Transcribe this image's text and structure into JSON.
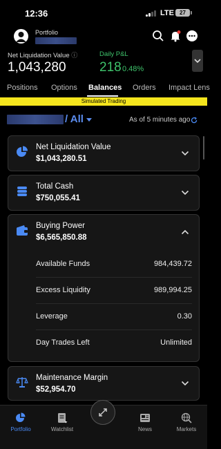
{
  "status": {
    "time": "12:36",
    "network": "LTE",
    "battery": "27"
  },
  "header": {
    "portfolio_label": "Portfolio"
  },
  "summary": {
    "liq_label": "Net Liquidation Value",
    "liq_value": "1,043,280",
    "pnl_label": "Daily P&L",
    "pnl_value": "218",
    "pnl_pct": "0.48%"
  },
  "tabs": [
    {
      "label": "Positions"
    },
    {
      "label": "Options"
    },
    {
      "label": "Balances"
    },
    {
      "label": "Orders"
    },
    {
      "label": "Impact Lens"
    }
  ],
  "active_tab": "Balances",
  "banner": "Simulated Trading",
  "account": {
    "selector": "/ All",
    "as_of": "As of 5 minutes ago"
  },
  "cards": {
    "nlv": {
      "title": "Net Liquidation Value",
      "value": "$1,043,280.51",
      "icon": "pie-chart-icon"
    },
    "cash": {
      "title": "Total Cash",
      "value": "$750,055.41",
      "icon": "coins-icon"
    },
    "buying_power": {
      "title": "Buying Power",
      "value": "$6,565,850.88",
      "icon": "wallet-icon",
      "rows": [
        {
          "label": "Available Funds",
          "value": "984,439.72"
        },
        {
          "label": "Excess Liquidity",
          "value": "989,994.25"
        },
        {
          "label": "Leverage",
          "value": "0.30"
        },
        {
          "label": "Day Trades Left",
          "value": "Unlimited"
        }
      ]
    },
    "maintenance": {
      "title": "Maintenance Margin",
      "value": "$52,954.70",
      "icon": "scales-icon"
    }
  },
  "nav": [
    {
      "label": "Portfolio"
    },
    {
      "label": "Watchlist"
    },
    {
      "label": "News"
    },
    {
      "label": "Markets"
    }
  ],
  "colors": {
    "accent": "#4a8af4",
    "positive": "#3ec26b",
    "banner": "#f5e51d"
  }
}
